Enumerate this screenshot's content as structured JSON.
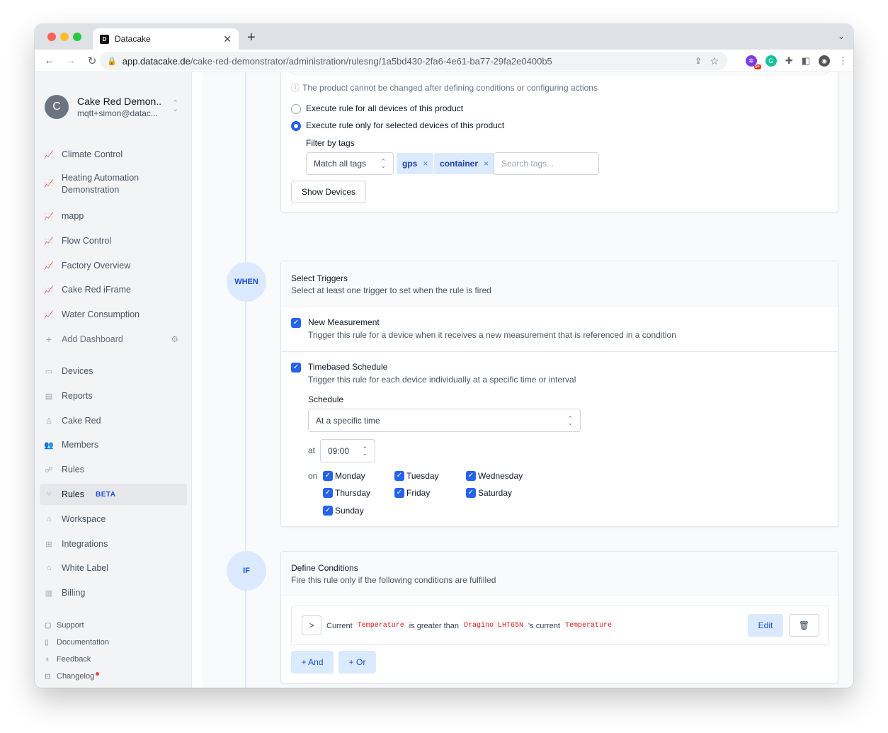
{
  "browser": {
    "tab_title": "Datacake",
    "tab_favicon": "D",
    "url_host": "app.datacake.de",
    "url_path": "/cake-red-demonstrator/administration/rulesng/1a5bd430-2fa6-4e61-ba77-29fa2e0400b5",
    "ext_badge": "9+"
  },
  "sidebar": {
    "avatar_letter": "C",
    "account_name": "Cake Red Demon...",
    "account_email": "mqtt+simon@datac...",
    "dashboards": [
      "Climate Control",
      "Heating Automation",
      "Demonstration",
      "mapp",
      "Flow Control",
      "Factory Overview",
      "Cake Red iFrame",
      "Water Consumption"
    ],
    "add_dashboard": "Add Dashboard",
    "nav": [
      "Devices",
      "Reports",
      "Cake Red",
      "Members",
      "Rules",
      "Rules",
      "Workspace",
      "Integrations",
      "White Label",
      "Billing"
    ],
    "beta": "BETA",
    "footer": [
      "Support",
      "Documentation",
      "Feedback",
      "Changelog"
    ]
  },
  "product": {
    "note": "The product cannot be changed after defining conditions or configuring actions",
    "radio_all": "Execute rule for all devices of this product",
    "radio_selected": "Execute rule only for selected devices of this product",
    "filter_label": "Filter by tags",
    "match_select": "Match all tags",
    "tags": [
      "gps",
      "container"
    ],
    "tag_remove": "×",
    "search_placeholder": "Search tags...",
    "show_devices": "Show Devices"
  },
  "when": {
    "badge": "WHEN",
    "title": "Select Triggers",
    "subtitle": "Select at least one trigger to set when the rule is fired",
    "trigger1_title": "New Measurement",
    "trigger1_desc": "Trigger this rule for a device when it receives a new measurement that is referenced in a condition",
    "trigger2_title": "Timebased Schedule",
    "trigger2_desc": "Trigger this rule for each device individually at a specific time or interval",
    "schedule_label": "Schedule",
    "schedule_value": "At a specific time",
    "at_label": "at",
    "time_value": "09:00",
    "on_label": "on",
    "days": [
      "Monday",
      "Tuesday",
      "Wednesday",
      "Thursday",
      "Friday",
      "Saturday",
      "Sunday"
    ]
  },
  "if": {
    "badge": "IF",
    "title": "Define Conditions",
    "subtitle": "Fire this rule only if the following conditions are fulfilled",
    "expand": ">",
    "c_current": "Current",
    "c_field": "Temperature",
    "c_op": "is greater than",
    "c_device": "Dragino LHT65N",
    "c_poss": "'s current",
    "c_field2": "Temperature",
    "edit": "Edit",
    "and": "+ And",
    "or": "+ Or"
  },
  "colors": {
    "accent": "#2563eb",
    "accent_light": "#dbeafe",
    "sidebar_bg": "#f3f4f6",
    "code_red": "#dc2626"
  },
  "icons": [
    "chart-icon",
    "plus-icon",
    "gear-icon",
    "devices-icon",
    "reports-icon",
    "user-icon",
    "members-icon",
    "rules-icon",
    "branch-icon",
    "home-icon",
    "integrations-icon",
    "tag-icon",
    "billing-icon",
    "chat-icon",
    "book-icon",
    "bulb-icon",
    "gift-icon",
    "info-icon",
    "trash-icon"
  ]
}
